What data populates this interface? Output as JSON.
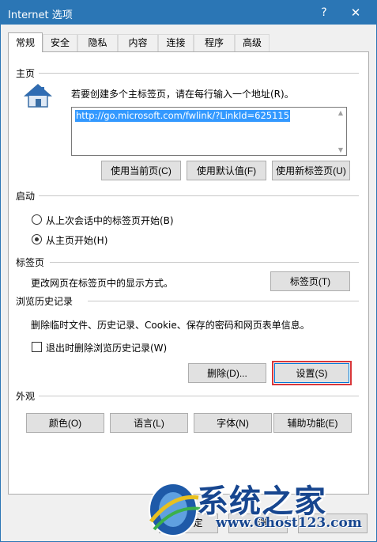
{
  "window": {
    "title": "Internet 选项",
    "help_glyph": "?",
    "close_glyph": "✕"
  },
  "tabs": [
    {
      "label": "常规",
      "active": true
    },
    {
      "label": "安全"
    },
    {
      "label": "隐私"
    },
    {
      "label": "内容"
    },
    {
      "label": "连接"
    },
    {
      "label": "程序"
    },
    {
      "label": "高级"
    }
  ],
  "home": {
    "section": "主页",
    "instruction": "若要创建多个主标签页，请在每行输入一个地址(R)。",
    "url": "http://go.microsoft.com/fwlink/?LinkId=625115",
    "buttons": {
      "current": "使用当前页(C)",
      "default": "使用默认值(F)",
      "newtab": "使用新标签页(U)"
    }
  },
  "startup": {
    "section": "启动",
    "option1": "从上次会话中的标签页开始(B)",
    "option2": "从主页开始(H)",
    "selected": 2
  },
  "tabs_section": {
    "section": "标签页",
    "description": "更改网页在标签页中的显示方式。",
    "button": "标签页(T)"
  },
  "history": {
    "section": "浏览历史记录",
    "description": "删除临时文件、历史记录、Cookie、保存的密码和网页表单信息。",
    "checkbox": "退出时删除浏览历史记录(W)",
    "checked": false,
    "delete_button": "删除(D)...",
    "settings_button": "设置(S)",
    "highlight_color": "#d9373a"
  },
  "appearance": {
    "section": "外观",
    "buttons": {
      "colors": "颜色(O)",
      "languages": "语言(L)",
      "fonts": "字体(N)",
      "accessibility": "辅助功能(E)"
    }
  },
  "bottom_partial": {
    "left": "定",
    "mid": "消"
  },
  "watermark": {
    "main": "系统之家",
    "url": "www.Ghost123.com"
  },
  "colors": {
    "titlebar": "#2b76b5",
    "selection": "#3399ff"
  }
}
